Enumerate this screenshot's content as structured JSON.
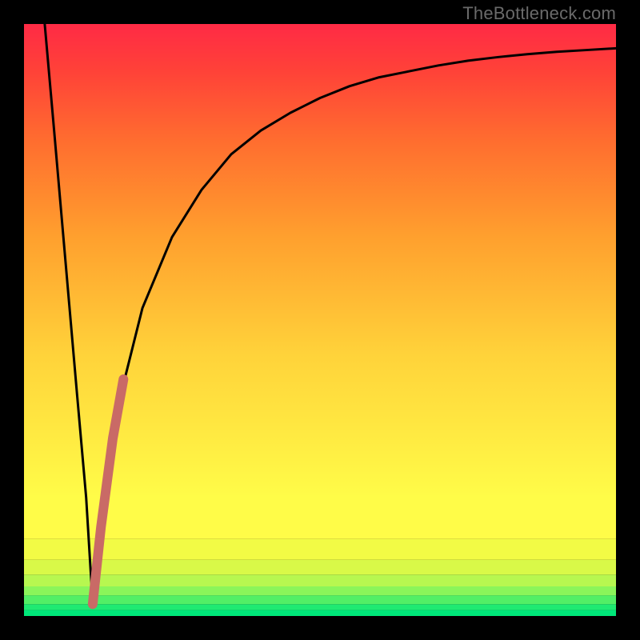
{
  "watermark": "TheBottleneck.com",
  "chart_data": {
    "type": "line",
    "title": "",
    "xlabel": "",
    "ylabel": "",
    "xlim": [
      0,
      100
    ],
    "ylim": [
      0,
      100
    ],
    "grid": false,
    "curve_x": [
      3.5,
      5,
      7,
      9,
      10.5,
      11.6,
      13,
      15,
      17,
      20,
      25,
      30,
      35,
      40,
      45,
      50,
      55,
      60,
      65,
      70,
      75,
      80,
      85,
      90,
      95,
      100
    ],
    "curve_y": [
      100,
      83,
      60,
      37,
      20,
      2,
      15,
      30,
      40,
      52,
      64,
      72,
      78,
      82,
      85,
      87.5,
      89.5,
      91,
      92,
      93,
      93.8,
      94.4,
      94.9,
      95.3,
      95.6,
      95.9
    ],
    "highlight_segment": {
      "x": [
        11.6,
        13,
        15,
        16.8
      ],
      "y": [
        2,
        15,
        30,
        40
      ]
    },
    "background_bands": [
      {
        "y0": 0.0,
        "y1": 1.0,
        "color": "#00e77a"
      },
      {
        "y0": 1.0,
        "y1": 2.0,
        "color": "#1fea72"
      },
      {
        "y0": 2.0,
        "y1": 3.5,
        "color": "#52ef66"
      },
      {
        "y0": 3.5,
        "y1": 5.0,
        "color": "#8af55a"
      },
      {
        "y0": 5.0,
        "y1": 7.0,
        "color": "#b7f750"
      },
      {
        "y0": 7.0,
        "y1": 9.5,
        "color": "#d9f948"
      },
      {
        "y0": 9.5,
        "y1": 13.0,
        "color": "#f2fb45"
      },
      {
        "y0": 13.0,
        "y1": 20.0,
        "color": "#fffc48"
      },
      {
        "y0": 20.0,
        "y1": 100.0,
        "gradient": true
      }
    ],
    "gradient_stops": [
      {
        "t": 0.0,
        "color": "#fffc48"
      },
      {
        "t": 0.3,
        "color": "#ffd33a"
      },
      {
        "t": 0.55,
        "color": "#ffa02e"
      },
      {
        "t": 0.75,
        "color": "#ff6e2f"
      },
      {
        "t": 0.9,
        "color": "#ff4238"
      },
      {
        "t": 1.0,
        "color": "#ff2a45"
      }
    ]
  }
}
